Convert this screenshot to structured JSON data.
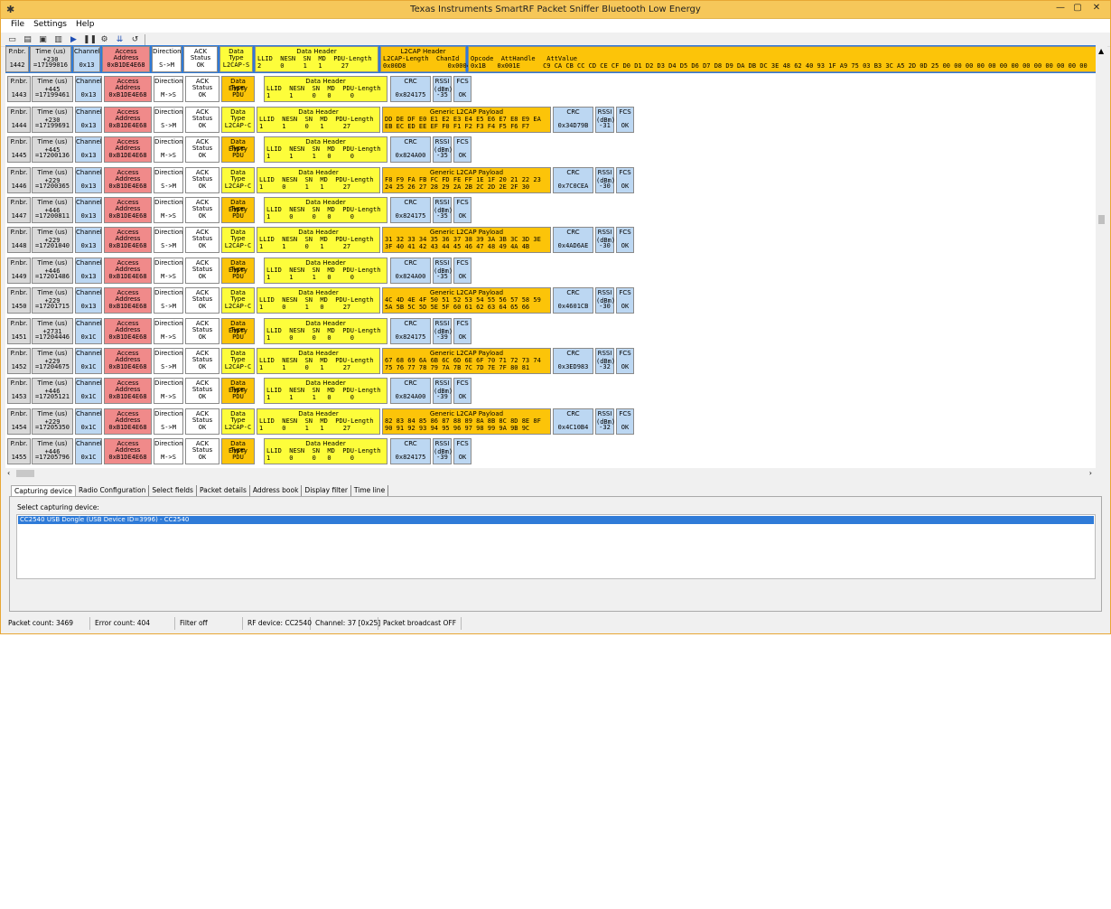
{
  "window": {
    "title": "Texas Instruments SmartRF Packet Sniffer Bluetooth Low Energy",
    "controls": [
      "—",
      "▢",
      "✕"
    ]
  },
  "menu": [
    "File",
    "Settings",
    "Help"
  ],
  "toolbar": [
    "new-icon",
    "open-icon",
    "save-icon",
    "folder-icon",
    "start-icon",
    "pause-icon",
    "settings-icon",
    "scroll-icon",
    "clear-icon"
  ],
  "headers": {
    "pnbr": "P.nbr.",
    "time": "Time (us)",
    "channel": "Channel",
    "access": "Access Address",
    "direction": "Direction",
    "ack": "ACK Status",
    "dtype": "Data Type",
    "dheader": "Data Header",
    "dh_cols": "LLID  NESN  SN  MD  PDU-Length",
    "l2cap": "L2CAP Header",
    "l2cap_cols": "L2CAP-Length  ChanId",
    "payload": "Generic L2CAP Payload",
    "crc": "CRC",
    "rssi1": "RSSI",
    "rssi2": "(dBm)",
    "fcs": "FCS",
    "opcode_cols": "Opcode  AttHandle   AttValue"
  },
  "rows": [
    {
      "n": "1442",
      "d": "+230",
      "t": "=17199016",
      "ch": "0x13",
      "aa": "0xB1DE4E68",
      "dir": "S->M",
      "ack": "OK",
      "dt": "L2CAP-S",
      "dh": "2     0     1   1     27",
      "l2": "0x00D8           0x0004",
      "att": "0x1B   0x001E      C9 CA CB CC CD CE CF D0 D1 D2 D3 D4 D5 D6 D7 D8 D9 DA DB DC 3E 48 62 40 93 1F A9 75 03 B3 3C A5 2D 0D 25 00 00 00 00 00 00 00 00 00 00 00 00 00"
    },
    {
      "n": "1443",
      "d": "+445",
      "t": "=17199461",
      "ch": "0x13",
      "aa": "0xB1DE4E68",
      "dir": "M->S",
      "ack": "OK",
      "dt": "Empty PDU",
      "dh": "1     1     0   0     0",
      "crc": "0x824175",
      "rssi": "-35",
      "fcs": "OK"
    },
    {
      "n": "1444",
      "d": "+230",
      "t": "=17199691",
      "ch": "0x13",
      "aa": "0xB1DE4E68",
      "dir": "S->M",
      "ack": "OK",
      "dt": "L2CAP-C",
      "dh": "1     1     0   1     27",
      "p1": "DD DE DF E0 E1 E2 E3 E4 E5 E6 E7 E8 E9 EA",
      "p2": "EB EC ED EE EF F0 F1 F2 F3 F4 F5 F6 F7",
      "crc": "0x34D79B",
      "rssi": "-31",
      "fcs": "OK"
    },
    {
      "n": "1445",
      "d": "+445",
      "t": "=17200136",
      "ch": "0x13",
      "aa": "0xB1DE4E68",
      "dir": "M->S",
      "ack": "OK",
      "dt": "Empty PDU",
      "dh": "1     1     1   0     0",
      "crc": "0x824A00",
      "rssi": "-35",
      "fcs": "OK"
    },
    {
      "n": "1446",
      "d": "+229",
      "t": "=17200365",
      "ch": "0x13",
      "aa": "0xB1DE4E68",
      "dir": "S->M",
      "ack": "OK",
      "dt": "L2CAP-C",
      "dh": "1     0     1   1     27",
      "p1": "F8 F9 FA FB FC FD FE FF 1E 1F 20 21 22 23",
      "p2": "24 25 26 27 28 29 2A 2B 2C 2D 2E 2F 30",
      "crc": "0x7C0CEA",
      "rssi": "-30",
      "fcs": "OK"
    },
    {
      "n": "1447",
      "d": "+446",
      "t": "=17200811",
      "ch": "0x13",
      "aa": "0xB1DE4E68",
      "dir": "M->S",
      "ack": "OK",
      "dt": "Empty PDU",
      "dh": "1     0     0   0     0",
      "crc": "0x824175",
      "rssi": "-35",
      "fcs": "OK"
    },
    {
      "n": "1448",
      "d": "+229",
      "t": "=17201040",
      "ch": "0x13",
      "aa": "0xB1DE4E68",
      "dir": "S->M",
      "ack": "OK",
      "dt": "L2CAP-C",
      "dh": "1     1     0   1     27",
      "p1": "31 32 33 34 35 36 37 38 39 3A 3B 3C 3D 3E",
      "p2": "3F 40 41 42 43 44 45 46 47 48 49 4A 4B",
      "crc": "0x4AD6AE",
      "rssi": "-30",
      "fcs": "OK"
    },
    {
      "n": "1449",
      "d": "+446",
      "t": "=17201486",
      "ch": "0x13",
      "aa": "0xB1DE4E68",
      "dir": "M->S",
      "ack": "OK",
      "dt": "Empty PDU",
      "dh": "1     1     1   0     0",
      "crc": "0x824A00",
      "rssi": "-35",
      "fcs": "OK"
    },
    {
      "n": "1450",
      "d": "+229",
      "t": "=17201715",
      "ch": "0x13",
      "aa": "0xB1DE4E68",
      "dir": "S->M",
      "ack": "OK",
      "dt": "L2CAP-C",
      "dh": "1     0     1   0     27",
      "p1": "4C 4D 4E 4F 50 51 52 53 54 55 56 57 58 59",
      "p2": "5A 5B 5C 5D 5E 5F 60 61 62 63 64 65 66",
      "crc": "0x4601CB",
      "rssi": "-30",
      "fcs": "OK"
    },
    {
      "n": "1451",
      "d": "+2731",
      "t": "=17204446",
      "ch": "0x1C",
      "aa": "0xB1DE4E68",
      "dir": "M->S",
      "ack": "OK",
      "dt": "Empty PDU",
      "dh": "1     0     0   0     0",
      "crc": "0x824175",
      "rssi": "-39",
      "fcs": "OK"
    },
    {
      "n": "1452",
      "d": "+229",
      "t": "=17204675",
      "ch": "0x1C",
      "aa": "0xB1DE4E68",
      "dir": "S->M",
      "ack": "OK",
      "dt": "L2CAP-C",
      "dh": "1     1     0   1     27",
      "p1": "67 68 69 6A 6B 6C 6D 6E 6F 70 71 72 73 74",
      "p2": "75 76 77 78 79 7A 7B 7C 7D 7E 7F 80 81",
      "crc": "0x3ED983",
      "rssi": "-32",
      "fcs": "OK"
    },
    {
      "n": "1453",
      "d": "+446",
      "t": "=17205121",
      "ch": "0x1C",
      "aa": "0xB1DE4E68",
      "dir": "M->S",
      "ack": "OK",
      "dt": "Empty PDU",
      "dh": "1     1     1   0     0",
      "crc": "0x824A00",
      "rssi": "-39",
      "fcs": "OK"
    },
    {
      "n": "1454",
      "d": "+229",
      "t": "=17205350",
      "ch": "0x1C",
      "aa": "0xB1DE4E68",
      "dir": "S->M",
      "ack": "OK",
      "dt": "L2CAP-C",
      "dh": "1     0     1   1     27",
      "p1": "82 83 84 85 86 87 88 89 8A 8B 8C 8D 8E 8F",
      "p2": "90 91 92 93 94 95 96 97 98 99 9A 9B 9C",
      "crc": "0x4C10B4",
      "rssi": "-32",
      "fcs": "OK"
    },
    {
      "n": "1455",
      "d": "+446",
      "t": "=17205796",
      "ch": "0x1C",
      "aa": "0xB1DE4E68",
      "dir": "M->S",
      "ack": "OK",
      "dt": "Empty PDU",
      "dh": "1     0     0   0     0",
      "crc": "0x824175",
      "rssi": "-39",
      "fcs": "OK"
    }
  ],
  "tabs": [
    "Capturing device",
    "Radio Configuration",
    "Select fields",
    "Packet details",
    "Address book",
    "Display filter",
    "Time line"
  ],
  "panel": {
    "label": "Select capturing device:",
    "device": "CC2540 USB Dongle (USB Device ID=3996) - CC2540"
  },
  "status": [
    "Packet count: 3469",
    "Error count: 404",
    "Filter off",
    "RF device: CC2540",
    "Channel: 37 [0x25]",
    "Packet broadcast OFF"
  ]
}
